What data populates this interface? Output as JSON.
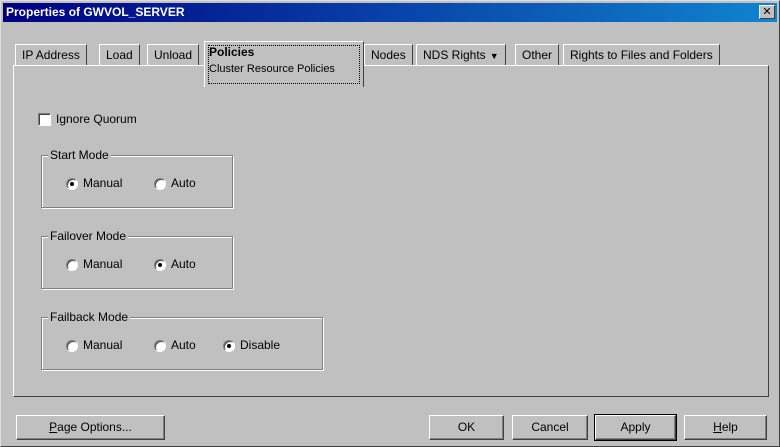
{
  "window": {
    "title": "Properties of GWVOL_SERVER",
    "close_glyph": "✕"
  },
  "tabs": [
    {
      "label": "IP Address"
    },
    {
      "label": "Load"
    },
    {
      "label": "Unload"
    },
    {
      "label": "Policies",
      "subtitle": "Cluster Resource Policies",
      "active": true
    },
    {
      "label": "Nodes"
    },
    {
      "label": "NDS Rights",
      "has_dropdown": true
    },
    {
      "label": "Other"
    },
    {
      "label": "Rights to Files and Folders"
    }
  ],
  "policies": {
    "ignore_quorum": {
      "label": "Ignore Quorum",
      "checked": false
    },
    "start_mode": {
      "title": "Start Mode",
      "options": [
        "Manual",
        "Auto"
      ],
      "selected": "Manual"
    },
    "failover_mode": {
      "title": "Failover Mode",
      "options": [
        "Manual",
        "Auto"
      ],
      "selected": "Auto"
    },
    "failback_mode": {
      "title": "Failback Mode",
      "options": [
        "Manual",
        "Auto",
        "Disable"
      ],
      "selected": "Disable"
    }
  },
  "buttons": {
    "page_options": "Page Options...",
    "ok": "OK",
    "cancel": "Cancel",
    "apply": "Apply",
    "help": "Help"
  },
  "icons": {
    "close": "close-icon",
    "dropdown": "triangle-down-icon"
  }
}
